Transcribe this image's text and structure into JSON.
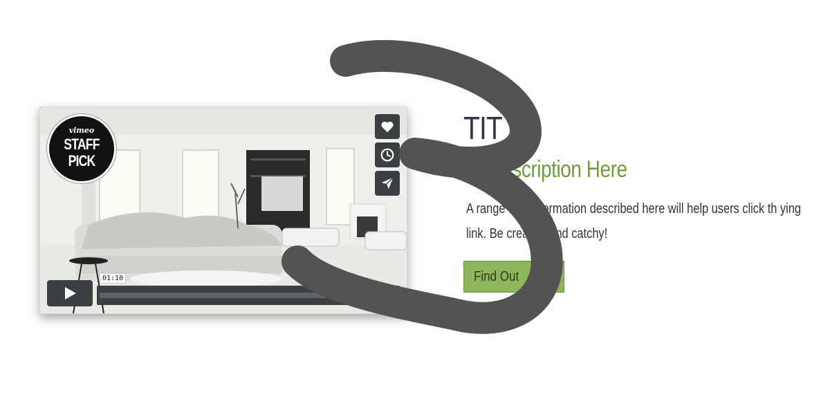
{
  "video": {
    "badge": {
      "brand": "vimeo",
      "line1": "STAFF",
      "line2": "PICK"
    },
    "actions": [
      {
        "name": "like",
        "icon": "heart-icon"
      },
      {
        "name": "watch-later",
        "icon": "clock-icon"
      },
      {
        "name": "share",
        "icon": "paper-plane-icon"
      }
    ],
    "player": {
      "play_icon": "play-icon",
      "time": "01:10"
    }
  },
  "content": {
    "title": "TIT",
    "subtitle": "eo Description Here",
    "body": "A   range and information described here will help users click th ying link. Be creative and catchy!",
    "button_label": "Find Out"
  },
  "colors": {
    "title": "#3d2c4c",
    "subtitle": "#6f9c3c",
    "button_bg": "#8db55a",
    "player_controls": "#3b4143",
    "overlay_stroke": "#535353"
  }
}
